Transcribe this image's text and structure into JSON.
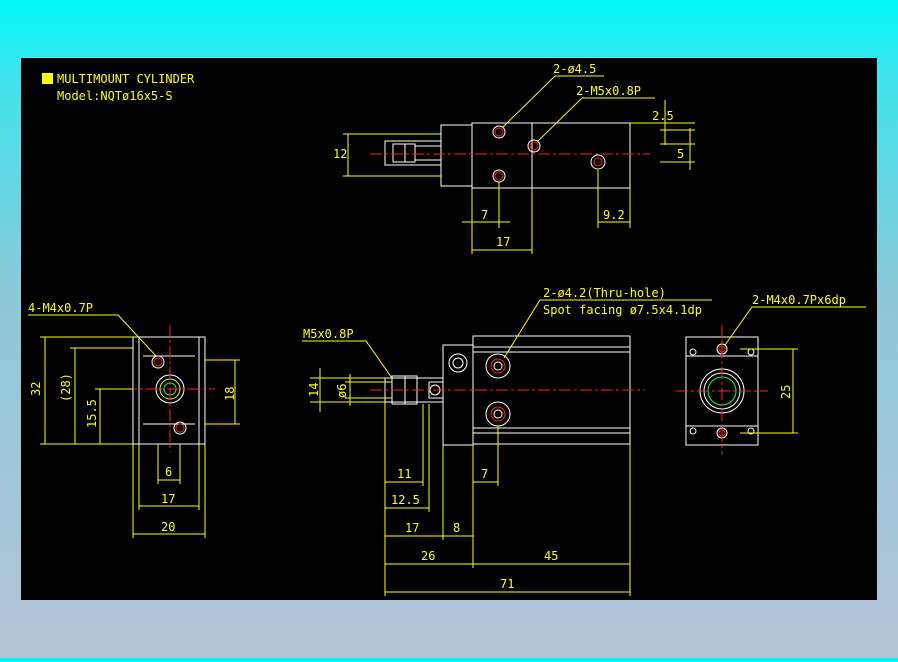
{
  "title": {
    "line1": "MULTIMOUNT CYLINDER",
    "line2": "Model:NQTø16x5-S",
    "marker_color": "#ffff00"
  },
  "colors": {
    "outer_top": "#00f8f8",
    "drawing_bg": "#000000",
    "dimension": "#ffff00",
    "outline": "#ffffff",
    "centerline": "#ff2020",
    "hidden": "#00ff60"
  },
  "top_view": {
    "callout_hole": "2-ø4.5",
    "callout_thread": "2-M5x0.8P",
    "dim_height": "12",
    "dim_right_top": "2.5",
    "dim_right": "5",
    "dim_left_bottom": "7",
    "dim_right_bottom": "9.2",
    "dim_bottom": "17"
  },
  "left_view": {
    "callout": "4-M4x0.7P",
    "dim_height": "32",
    "dim_inner": "(28)",
    "dim_center": "15.5",
    "dim_right": "18",
    "dim_bottom_small": "6",
    "dim_bottom_mid": "17",
    "dim_bottom_wide": "20"
  },
  "front_view": {
    "callout_rod": "M5x0.8P",
    "callout_thru_line1": "2-ø4.2(Thru-hole)",
    "callout_thru_line2": "Spot facing ø7.5x4.1dp",
    "dim_left_outer": "14",
    "dim_left_inner": "ø6",
    "dim_11": "11",
    "dim_12_5": "12.5",
    "dim_17": "17",
    "dim_8": "8",
    "dim_7": "7",
    "dim_26": "26",
    "dim_45": "45",
    "dim_71": "71"
  },
  "end_view": {
    "callout": "2-M4x0.7Px6dp",
    "dim_right": "25"
  }
}
